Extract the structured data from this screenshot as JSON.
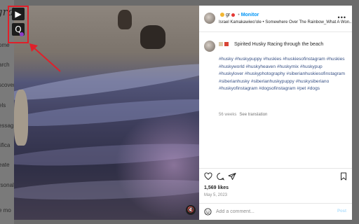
{
  "background_nav": {
    "logo": "gra",
    "items": [
      "ome",
      "arch",
      "scover",
      "els",
      "essag",
      "tifica",
      "eate",
      "rsonal",
      "e mo"
    ]
  },
  "extension": {
    "icons": [
      "play-download-icon",
      "quick-save-icon"
    ],
    "highlight_color": "#e0202a",
    "arrow_color": "#e0202a"
  },
  "post": {
    "header": {
      "username": "gr",
      "separator": "•",
      "follow_label": "Monitor",
      "audio": "Israel Kamakawiwo'ole • Somewhere Over The Rainbow_What A Won..."
    },
    "caption": {
      "title": "Spirited Husky Racing through the beach",
      "hashtags": "#husky #huskypuppy #huskies #huskiesofinstagram #huskies #huskyworld #huskyheaven #huskymix #huskypup #huskylover #huskyphotography #siberianhuskiesofinstagram #siberianhusky #siberianhuskypuppy #huskysiberiano #huskyofinstagram #dogsofinstagram #pet #dogs",
      "age": "56 weeks",
      "translate_label": "See translation"
    },
    "likes": "1,569 likes",
    "date": "May 5, 2023",
    "comment_placeholder": "Add a comment...",
    "post_label": "Post"
  },
  "colors": {
    "link": "#385185",
    "accent": "#0095f6",
    "post_disabled": "#b2dffc"
  }
}
